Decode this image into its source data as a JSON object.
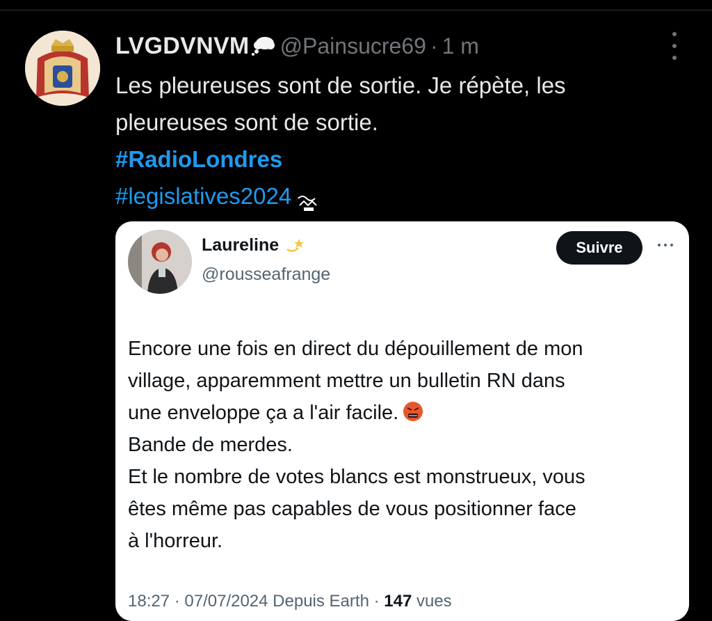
{
  "tweet": {
    "display_name": "LVGDVNVM",
    "handle": "@Painsucre69",
    "separator": "·",
    "time": "1 m",
    "text_lines": [
      "Les pleureuses sont de sortie. Je répète, les",
      "pleureuses sont de sortie."
    ],
    "hashtags": [
      "#RadioLondres",
      "#legislatives2024"
    ],
    "avatar_icon": "royal-coat-of-arms",
    "name_emoji": "thought-balloon-emoji",
    "hashtag_sticker": "sticker-emoji"
  },
  "quote": {
    "display_name": "Laureline",
    "name_emoji": "dizzy-star-emoji",
    "handle": "@rousseafrange",
    "follow_label": "Suivre",
    "text_lines": [
      "Encore une fois en direct du dépouillement de mon",
      "village, apparemment mettre un bulletin RN dans",
      "une enveloppe ça a l'air facile.",
      "Bande de merdes.",
      "Et le nombre de votes blancs est monstrueux, vous",
      "êtes même pas capables de vous positionner face",
      "à l'horreur."
    ],
    "inline_emoji": "angry-face-emoji",
    "footer": {
      "timestamp": "18:27 · 07/07/2024 Depuis Earth ·",
      "views_count": "147",
      "views_label": "vues"
    }
  },
  "colors": {
    "background": "#000000",
    "text": "#e7e9ea",
    "muted": "#71767b",
    "link": "#1d9bf0",
    "card": "#ffffff",
    "button": "#0f1419"
  }
}
